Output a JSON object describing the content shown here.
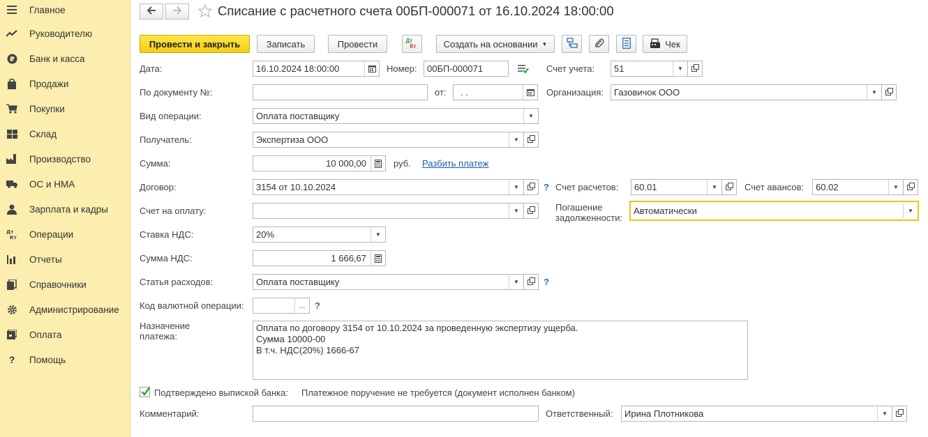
{
  "sidebar": {
    "items": [
      {
        "label": "Главное",
        "icon": "menu-icon"
      },
      {
        "label": "Руководителю",
        "icon": "chart-trend-icon"
      },
      {
        "label": "Банк и касса",
        "icon": "ruble-icon"
      },
      {
        "label": "Продажи",
        "icon": "shopping-bag-icon"
      },
      {
        "label": "Покупки",
        "icon": "cart-icon"
      },
      {
        "label": "Склад",
        "icon": "warehouse-icon"
      },
      {
        "label": "Производство",
        "icon": "factory-icon"
      },
      {
        "label": "ОС и НМА",
        "icon": "truck-icon"
      },
      {
        "label": "Зарплата и кадры",
        "icon": "person-icon"
      },
      {
        "label": "Операции",
        "icon": "dt-kt-icon"
      },
      {
        "label": "Отчеты",
        "icon": "bar-chart-icon"
      },
      {
        "label": "Справочники",
        "icon": "books-icon"
      },
      {
        "label": "Администрирование",
        "icon": "gear-icon"
      },
      {
        "label": "Оплата",
        "icon": "payment-icon"
      },
      {
        "label": "Помощь",
        "icon": "question-icon"
      }
    ]
  },
  "header": {
    "title": "Списание с расчетного счета 00БП-000071 от 16.10.2024 18:00:00"
  },
  "toolbar": {
    "post_close": "Провести и закрыть",
    "save": "Записать",
    "post": "Провести",
    "dt_kt_top": "Дт",
    "dt_kt_bottom": "Кт",
    "create_based": "Создать на основании",
    "receipt": "Чек"
  },
  "form": {
    "date_label": "Дата:",
    "date_value": "16.10.2024 18:00:00",
    "number_label": "Номер:",
    "number_value": "00БП-000071",
    "account_label": "Счет учета:",
    "account_value": "51",
    "doc_no_label": "По документу №:",
    "doc_no_value": "",
    "from_label": "от:",
    "from_value": " .  .",
    "org_label": "Организация:",
    "org_value": "Газовичок ООО",
    "op_type_label": "Вид операции:",
    "op_type_value": "Оплата поставщику",
    "recipient_label": "Получатель:",
    "recipient_value": "Экспертиза ООО",
    "amount_label": "Сумма:",
    "amount_value": "10 000,00",
    "currency": "руб.",
    "split_payment": "Разбить платеж",
    "contract_label": "Договор:",
    "contract_value": "3154 от 10.10.2024",
    "settle_account_label": "Счет расчетов:",
    "settle_account_value": "60.01",
    "advance_account_label": "Счет авансов:",
    "advance_account_value": "60.02",
    "invoice_label": "Счет на оплату:",
    "invoice_value": "",
    "debt_repay_label_1": "Погашение",
    "debt_repay_label_2": "задолженности:",
    "debt_repay_value": "Автоматически",
    "vat_rate_label": "Ставка НДС:",
    "vat_rate_value": "20%",
    "vat_sum_label": "Сумма НДС:",
    "vat_sum_value": "1 666,67",
    "expense_item_label": "Статья расходов:",
    "expense_item_value": "Оплата поставщику",
    "currency_op_code_label": "Код валютной операции:",
    "currency_op_code_value": "",
    "purpose_label_1": "Назначение",
    "purpose_label_2": "платежа:",
    "purpose_lines": [
      "Оплата по договору 3154 от 10.10.2024 за проведенную экспертизу ущерба.",
      "Сумма 10000-00",
      "В т.ч. НДС(20%) 1666-67"
    ],
    "confirmed_label": "Подтверждено выпиской банка:",
    "confirmed_checked": true,
    "payment_order_note": "Платежное поручение не требуется (документ исполнен банком)",
    "comment_label": "Комментарий:",
    "comment_value": "",
    "responsible_label": "Ответственный:",
    "responsible_value": "Ирина Плотникова",
    "help_mark": "?",
    "dots": "..."
  },
  "colors": {
    "sidebar_bg": "#fbeeae",
    "primary_button": "#f4cf12",
    "link": "#1a5ea8",
    "help": "#1f6fb5",
    "focus_border": "#f2c511"
  }
}
